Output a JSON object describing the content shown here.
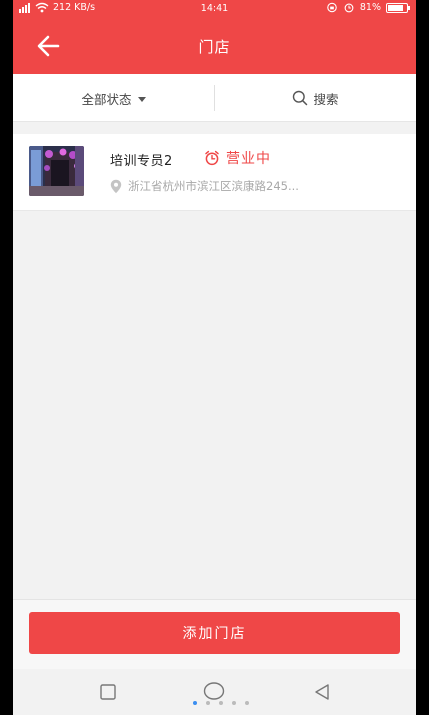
{
  "statusbar": {
    "net_speed": "212 KB/s",
    "time": "14:41",
    "battery": "81%",
    "battery_level": 0.81
  },
  "header": {
    "title": "门店"
  },
  "filters": {
    "status_label": "全部状态",
    "search_label": "搜索"
  },
  "stores": [
    {
      "name": "培训专员2",
      "status": "营业中",
      "address": "浙江省杭州市滨江区滨康路245..."
    }
  ],
  "actions": {
    "add_store_label": "添加门店"
  },
  "colors": {
    "brand_red": "#ef4747",
    "page_bg": "#f2f2f2",
    "muted_text": "#a8a8a8"
  },
  "icons": {
    "back": "arrow-left-icon",
    "status_caret": "caret-down-icon",
    "search": "magnifier-icon",
    "open_status": "alarm-clock-icon",
    "address": "location-pin-icon"
  },
  "navbar": {
    "page_count": 5,
    "active_page": 1
  }
}
